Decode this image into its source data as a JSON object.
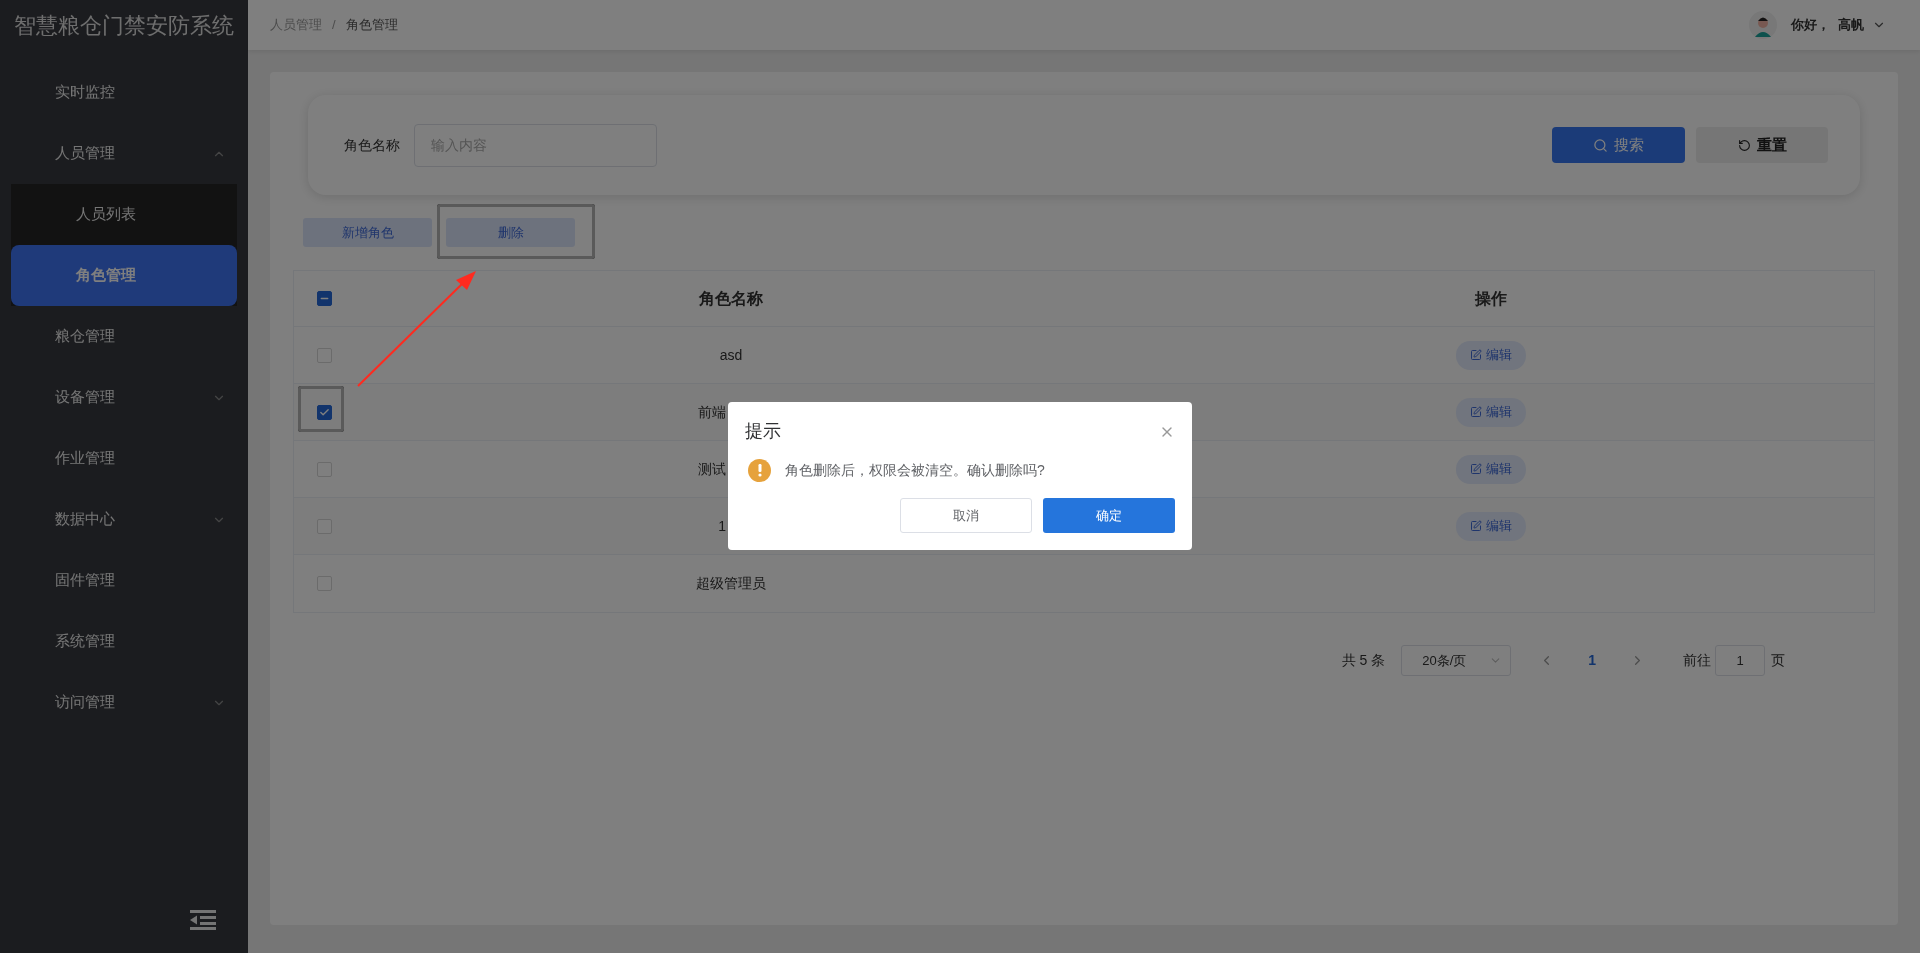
{
  "sidebar": {
    "title": "智慧粮仓门禁安防系统",
    "items": [
      {
        "label": "实时监控",
        "selected": false
      },
      {
        "label": "人员管理",
        "expanded": true,
        "selected": false,
        "children": [
          {
            "label": "人员列表",
            "selected": false
          },
          {
            "label": "角色管理",
            "selected": true
          }
        ]
      },
      {
        "label": "粮仓管理",
        "selected": false
      },
      {
        "label": "设备管理",
        "expanded": false,
        "selected": false
      },
      {
        "label": "作业管理",
        "selected": false
      },
      {
        "label": "数据中心",
        "expanded": false,
        "selected": false
      },
      {
        "label": "固件管理",
        "selected": false
      },
      {
        "label": "系统管理",
        "selected": false
      },
      {
        "label": "访问管理",
        "expanded": false,
        "selected": false
      }
    ]
  },
  "breadcrumb": [
    "人员管理",
    "/",
    "角色管理"
  ],
  "user": {
    "greeting": "你好，",
    "name": "高帆"
  },
  "search": {
    "label": "角色名称",
    "placeholder": "输入内容",
    "search_button": "搜索",
    "reset_button": "重置"
  },
  "actions": [
    "新增角色",
    "删除"
  ],
  "table": {
    "columns": [
      "角色名称",
      "操作"
    ],
    "header_indeterminate": true,
    "rows": [
      {
        "name": "asd",
        "checked": false,
        "action": "编辑"
      },
      {
        "name": "前端",
        "cut": true,
        "checked": true,
        "action": "编辑"
      },
      {
        "name": "测试",
        "cut": true,
        "checked": false,
        "action": "编辑"
      },
      {
        "name": "1",
        "cut": true,
        "checked": false,
        "action": "编辑"
      },
      {
        "name": "超级管理员",
        "checked": false
      }
    ]
  },
  "pagination": {
    "total": "共 5 条",
    "page_size": "20条/页",
    "current": "1",
    "goto_label": "前往",
    "goto_value": "1",
    "goto_suffix": "页"
  },
  "dialog": {
    "title": "提示",
    "message": "角色删除后，权限会被清空。确认删除吗?",
    "cancel": "取消",
    "confirm": "确定"
  }
}
